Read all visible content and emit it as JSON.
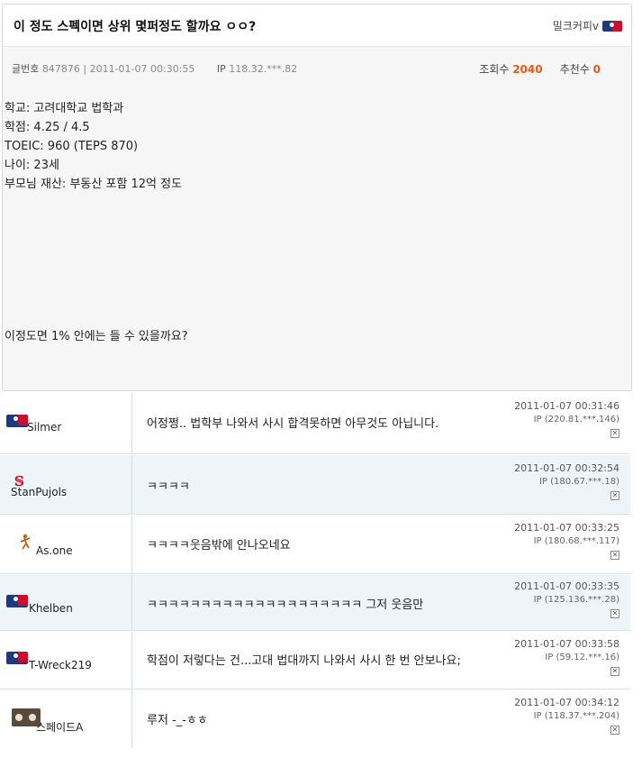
{
  "post": {
    "title": "이 정도 스펙이면 상위 몇퍼정도 할까요 ㅇㅇ?",
    "author": "밀크커피v",
    "meta": {
      "number_label": "글번호",
      "number": "847876",
      "datetime": "2011-01-07 00:30:55",
      "ip_label": "IP",
      "ip": "118.32.***.82",
      "views_label": "조회수",
      "views": "2040",
      "recommend_label": "추천수",
      "recommend": "0"
    },
    "body_lines": [
      "학교: 고려대학교 법학과",
      "학점: 4.25 / 4.5",
      "TOEIC: 960 (TEPS 870)",
      "나이: 23세",
      "부모님 재산: 부동산 포함 12억 정도"
    ],
    "question": "이정도면 1% 안에는 들 수 있을까요?"
  },
  "comments": [
    {
      "name": "Silmer",
      "icon": "mlb-logo-icon",
      "text": "어정쩡.. 법학부 나와서 사시 합격못하면 아무것도 아닙니다.",
      "date": "2011-01-07 00:31:46",
      "ip": "IP (220.81.***.146)",
      "delete": "✕"
    },
    {
      "name": "StanPujols",
      "icon": "cardinals-logo-icon",
      "text": "ㅋㅋㅋㅋ",
      "date": "2011-01-07 00:32:54",
      "ip": "IP (180.67.***.18)",
      "delete": "✕"
    },
    {
      "name": "As.one",
      "icon": "pitcher-icon",
      "text": "ㅋㅋㅋㅋ웃음밖에 안나오네요",
      "date": "2011-01-07 00:33:25",
      "ip": "IP (180.68.***.117)",
      "delete": "✕"
    },
    {
      "name": "Khelben",
      "icon": "mlb-logo-icon",
      "text": "ㅋㅋㅋㅋㅋㅋㅋㅋㅋㅋㅋㅋㅋㅋㅋㅋㅋㅋㅋㅋ 그저 웃음만",
      "date": "2011-01-07 00:33:35",
      "ip": "IP (125.136.***.28)",
      "delete": "✕"
    },
    {
      "name": "T-Wreck219",
      "icon": "mlb-logo-icon",
      "text": "학점이 저렇다는 건...고대 법대까지 나와서 사시 한 번 안보나요;",
      "date": "2011-01-07 00:33:58",
      "ip": "IP (59.12.***.16)",
      "delete": "✕"
    },
    {
      "name": "스페이드A",
      "icon": "panda-avatar-icon",
      "text": "루저 -_-ㅎㅎ",
      "date": "2011-01-07 00:34:12",
      "ip": "IP (118.37.***.204)",
      "delete": "✕"
    }
  ]
}
